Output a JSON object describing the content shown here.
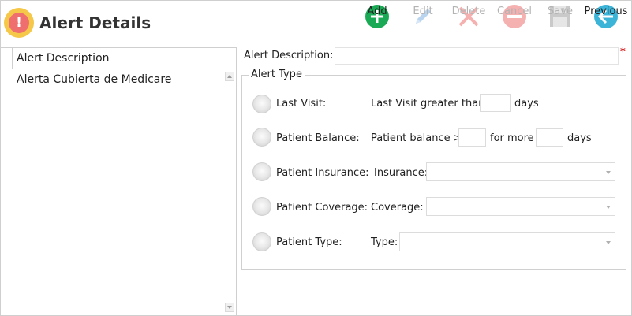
{
  "header": {
    "title": "Alert Details"
  },
  "toolbar": {
    "add": "Add",
    "edit": "Edit",
    "delete": "Delete",
    "cancel": "Cancel",
    "save": "Save",
    "previous": "Previous"
  },
  "list": {
    "header": "Alert Description",
    "rows": [
      "Alerta Cubierta de Medicare"
    ]
  },
  "form": {
    "description_label": "Alert Description:",
    "description_value": "",
    "required_marker": "*",
    "group_title": "Alert Type",
    "last_visit": {
      "label": "Last Visit:",
      "prefix": "Last Visit greater than",
      "value": "",
      "suffix": "days"
    },
    "patient_balance": {
      "label": "Patient Balance:",
      "prefix": "Patient balance >",
      "amount": "",
      "middle": "for more",
      "days": "",
      "suffix": "days"
    },
    "patient_insurance": {
      "label": "Patient Insurance:",
      "field_label": "Insurance:",
      "selected": ""
    },
    "patient_coverage": {
      "label": "Patient Coverage:",
      "field_label": "Coverage:",
      "selected": ""
    },
    "patient_type": {
      "label": "Patient Type:",
      "field_label": "Type:",
      "selected": ""
    }
  },
  "colors": {
    "add": "#1aaa55",
    "edit": "#b8d4ef",
    "delete": "#f5b0b0",
    "cancel": "#f5b0b0",
    "save": "#c9c9c9",
    "previous": "#3cb4d8",
    "required": "#d42020",
    "title_icon_outer": "#f5c84a",
    "title_icon_inner": "#ef6f6f"
  }
}
